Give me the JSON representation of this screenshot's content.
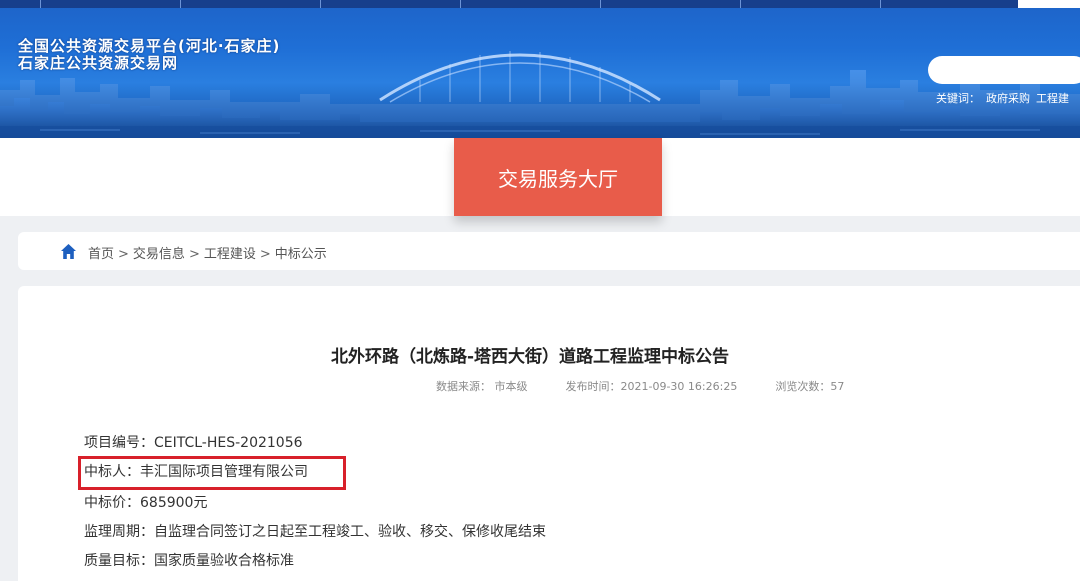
{
  "header": {
    "title_line1": "全国公共资源交易平台(河北·石家庄)",
    "title_line2": "石家庄公共资源交易网",
    "search_placeholder": "",
    "keywords_label": "关键词：",
    "keywords": [
      "政府采购",
      "工程建"
    ]
  },
  "nav": {
    "hall_label": "交易服务大厅"
  },
  "breadcrumb": {
    "items": [
      "首页",
      "交易信息",
      "工程建设",
      "中标公示"
    ],
    "separator": ">"
  },
  "article": {
    "title": "北外环路（北炼路-塔西大街）道路工程监理中标公告",
    "meta_source": "数据来源： 市本级",
    "meta_published": "发布时间：2021-09-30 16:26:25",
    "meta_views": "浏览次数：57",
    "details": [
      "项目编号：CEITCL-HES-2021056",
      "中标人：丰汇国际项目管理有限公司",
      "中标价：685900元",
      "监理周期：自监理合同签订之日起至工程竣工、验收、移交、保修收尾结束",
      "质量目标：国家质量验收合格标准"
    ]
  },
  "colors": {
    "banner_blue": "#1f6fd6",
    "hall_red": "#e85c4a",
    "highlight_red": "#d8202a",
    "home_icon_blue": "#1d5fbf"
  }
}
